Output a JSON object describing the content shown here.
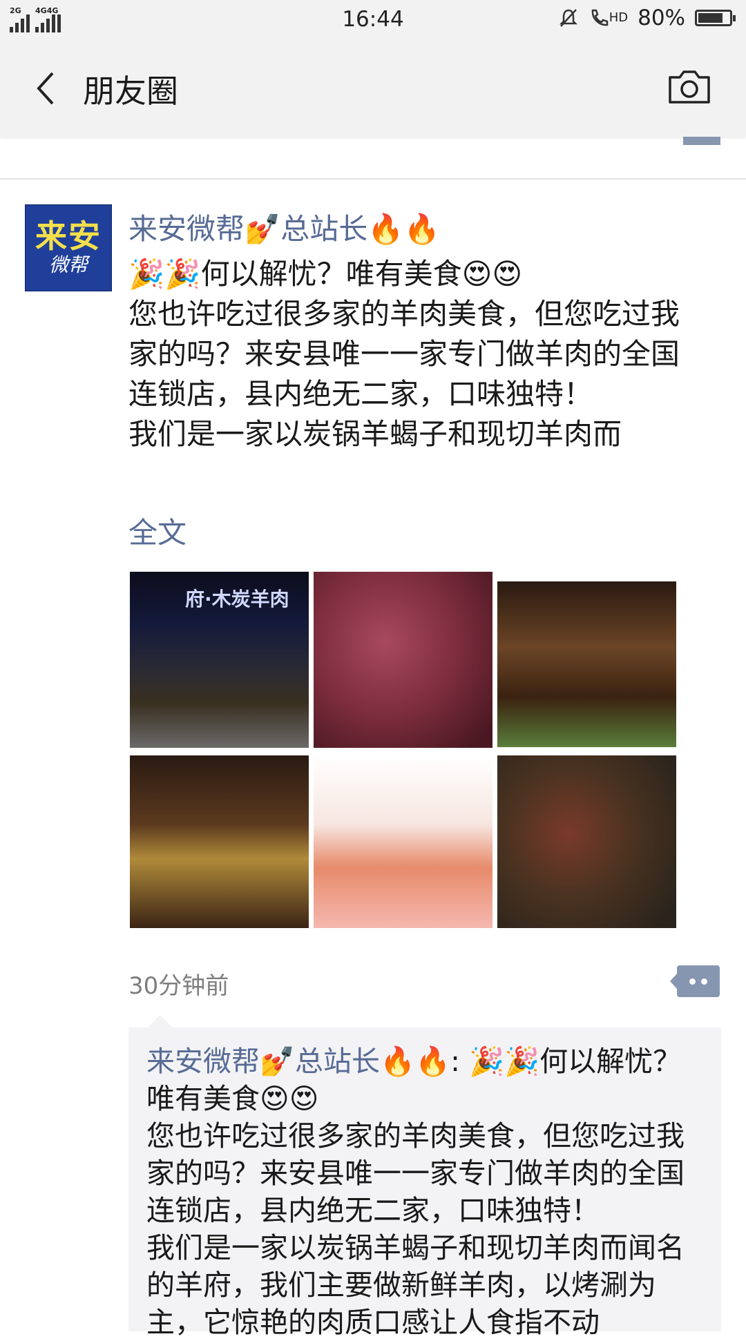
{
  "status_bar": {
    "network_label_1": "2G",
    "network_label_2": "4G",
    "network_label_3": "4G",
    "time": "16:44",
    "hd_label": "HD",
    "battery": "80%",
    "battery_level": 0.8
  },
  "nav": {
    "title": "朋友圈"
  },
  "post": {
    "avatar_line1": "来安",
    "avatar_line2": "微帮",
    "author": "来安微帮💅总站长🔥🔥",
    "lines": [
      "🎉🎉何以解忧？唯有美食😍😍",
      "您也许吃过很多家的羊肉美食，但您吃过我家的吗？来安县唯一一家专门做羊肉的全国连锁店，县内绝无二家，口味独特！",
      "我们是一家以炭锅羊蝎子和现切羊肉而"
    ],
    "full_text_link": "全文",
    "photo_sign_text": "府·木炭羊肉",
    "time": "30分钟前"
  },
  "comments": [
    {
      "author": "来安微帮💅总站长🔥🔥",
      "separator": ": ",
      "text": "🎉🎉何以解忧？唯有美食😍😍\n您也许吃过很多家的羊肉美食，但您吃过我家的吗？来安县唯一一家专门做羊肉的全国连锁店，县内绝无二家，口味独特！\n我们是一家以炭锅羊蝎子和现切羊肉而闻名的羊府，我们主要做新鲜羊肉，以烤涮为主，它惊艳的肉质口感让人食指不动"
    }
  ]
}
